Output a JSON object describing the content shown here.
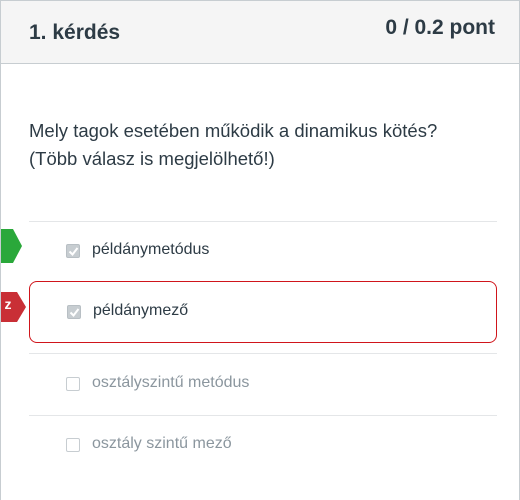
{
  "question": {
    "title": "1. kérdés",
    "points": "0 / 0.2 pont",
    "text_line1": "Mely tagok esetében működik a dinamikus kötés?",
    "text_line2": "(Több válasz is megjelölhető!)"
  },
  "answers": [
    {
      "label": "példánymetódus",
      "checked": true,
      "state": "correct"
    },
    {
      "label": "példánymező",
      "checked": true,
      "state": "incorrect"
    },
    {
      "label": "osztályszintű metódus",
      "checked": false,
      "state": "none"
    },
    {
      "label": "osztály szintű mező",
      "checked": false,
      "state": "none"
    }
  ],
  "markers": {
    "incorrect_marker_text": "z"
  },
  "colors": {
    "correct": "#2aa83a",
    "incorrect": "#d0151b",
    "text": "#2d3b45",
    "muted_text": "#8b969e"
  }
}
